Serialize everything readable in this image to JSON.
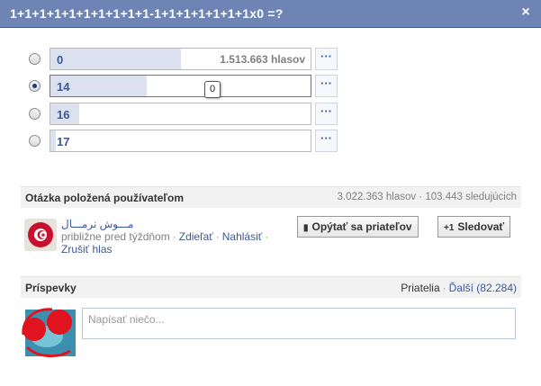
{
  "dialog": {
    "title": "1+1+1+1+1+1+1+1+1+1-1+1+1+1+1+1+1x0 =?",
    "close_glyph": "×"
  },
  "options": [
    {
      "label": "0",
      "votes": "1.513.663 hlasov",
      "share": 0.5,
      "checked": false
    },
    {
      "label": "14",
      "votes": "",
      "share": 0.37,
      "checked": true,
      "tooltip": "0"
    },
    {
      "label": "16",
      "votes": "",
      "share": 0.11,
      "checked": false
    },
    {
      "label": "17",
      "votes": "",
      "share": 0.02,
      "checked": false
    }
  ],
  "more_glyph": "···",
  "asked": {
    "label": "Otázka položená používateľom",
    "stats": "3.022.363 hlasov · 103.443 sledujúcich"
  },
  "author": {
    "name": "مـــوش نرمـــال",
    "time": "približne pred týždňom",
    "share_link": "Zdieľať",
    "report_link": "Nahlásiť",
    "cancel_vote_link": "Zrušiť hlas"
  },
  "buttons": {
    "ask_friends": "Opýtať sa priateľov",
    "follow": "Sledovať"
  },
  "posts": {
    "label": "Príspevky",
    "friends": "Priatelia",
    "more": "Ďalší (82.284)"
  },
  "comment": {
    "placeholder": "Napísať niečo..."
  },
  "colors": {
    "header": "#6d84b4",
    "link": "#3b5998",
    "bar_fill": "#dbe1ee"
  }
}
